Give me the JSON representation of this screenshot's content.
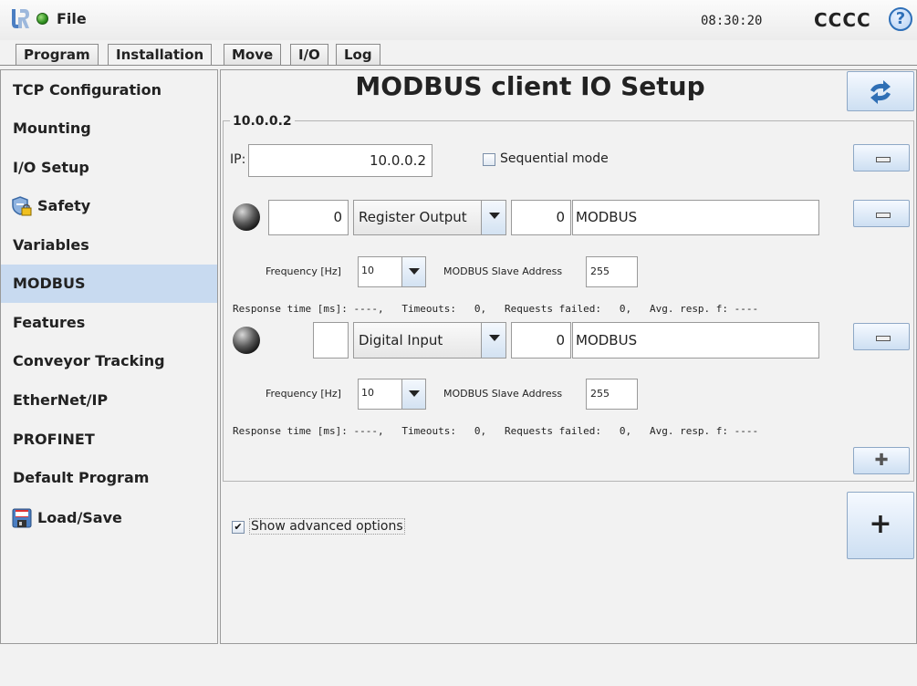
{
  "header": {
    "file_label": "File",
    "time": "08:30:20",
    "robot_name": "CCCC",
    "help_symbol": "?"
  },
  "tabs": [
    {
      "label": "Program",
      "active": false
    },
    {
      "label": "Installation",
      "active": true
    },
    {
      "label": "Move",
      "active": false
    },
    {
      "label": "I/O",
      "active": false
    },
    {
      "label": "Log",
      "active": false
    }
  ],
  "sidebar": {
    "items": [
      {
        "label": "TCP Configuration"
      },
      {
        "label": "Mounting"
      },
      {
        "label": "I/O Setup"
      },
      {
        "label": "Safety",
        "icon": "shield-lock-icon"
      },
      {
        "label": "Variables"
      },
      {
        "label": "MODBUS",
        "selected": true
      },
      {
        "label": "Features"
      },
      {
        "label": "Conveyor Tracking"
      },
      {
        "label": "EtherNet/IP"
      },
      {
        "label": "PROFINET"
      },
      {
        "label": "Default Program"
      },
      {
        "label": "Load/Save",
        "icon": "floppy-disk-icon"
      }
    ]
  },
  "main": {
    "title": "MODBUS client IO Setup",
    "group_title": "10.0.0.2",
    "ip_label": "IP:",
    "ip_value": "10.0.0.2",
    "sequential_mode_label": "Sequential mode",
    "sequential_mode_checked": false,
    "signals": [
      {
        "address": "0",
        "type": "Register Output",
        "value": "0",
        "name": "MODBUS",
        "frequency_label": "Frequency [Hz]",
        "frequency": "10",
        "slave_address_label": "MODBUS Slave Address",
        "slave_address": "255",
        "status_line": "Response time [ms]: ----,   Timeouts:   0,   Requests failed:   0,   Avg. resp. f: ----"
      },
      {
        "address": "",
        "type": "Digital Input",
        "value": "0",
        "name": "MODBUS",
        "frequency_label": "Frequency [Hz]",
        "frequency": "10",
        "slave_address_label": "MODBUS Slave Address",
        "slave_address": "255",
        "status_line": "Response time [ms]: ----,   Timeouts:   0,   Requests failed:   0,   Avg. resp. f: ----"
      }
    ],
    "show_advanced_label": "Show advanced options",
    "show_advanced_checked": true,
    "add_symbol": "+",
    "add_signal_symbol": "✚"
  },
  "colors": {
    "selected_sidebar_bg": "#c8daf0",
    "button_blue": "#cddff2",
    "status_green": "#2f8f1f"
  }
}
